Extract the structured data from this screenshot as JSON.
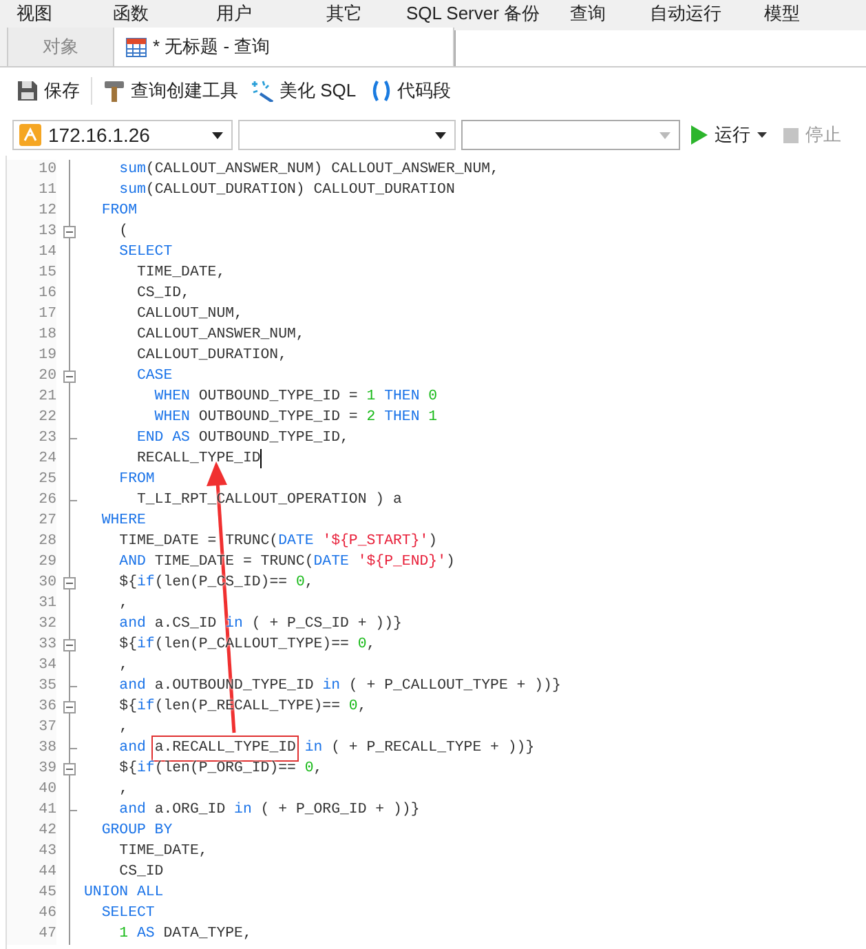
{
  "menu": [
    "视图",
    "函数",
    "用户",
    "其它",
    "SQL Server 备份",
    "查询",
    "自动运行",
    "模型"
  ],
  "tabs": [
    {
      "label": "对象",
      "selected": false,
      "icon": false
    },
    {
      "label": "* 无标题 - 查询",
      "selected": true,
      "icon": true
    }
  ],
  "toolbar": [
    {
      "kind": "save",
      "label": "保存"
    },
    {
      "kind": "builder",
      "label": "查询创建工具"
    },
    {
      "kind": "beautify",
      "label": "美化 SQL"
    },
    {
      "kind": "snippet",
      "label": "代码段"
    }
  ],
  "selectors": [
    {
      "value": "172.16.1.26",
      "disabled": false,
      "icon": true
    },
    {
      "disabled": false,
      "icon": false
    },
    {
      "disabled": true,
      "icon": false
    }
  ],
  "run": {
    "label": "运行",
    "disabled": false
  },
  "stop": {
    "label": "停止",
    "disabled": true
  },
  "editor": {
    "lines": [
      {
        "number": "10",
        "fold": false,
        "fold_end": false,
        "cursor": false,
        "tokens": [
          {
            "kind": "fn",
            "text": "    sum"
          },
          {
            "kind": "plain",
            "text": "(CALLOUT_ANSWER_NUM) CALLOUT_ANSWER_NUM,"
          }
        ]
      },
      {
        "number": "11",
        "fold": false,
        "fold_end": false,
        "cursor": false,
        "tokens": [
          {
            "kind": "fn",
            "text": "    sum"
          },
          {
            "kind": "plain",
            "text": "(CALLOUT_DURATION) CALLOUT_DURATION"
          }
        ]
      },
      {
        "number": "12",
        "fold": false,
        "fold_end": false,
        "cursor": false,
        "tokens": [
          {
            "kind": "kw",
            "text": "  FROM"
          }
        ]
      },
      {
        "number": "13",
        "fold": true,
        "fold_end": false,
        "cursor": false,
        "tokens": [
          {
            "kind": "plain",
            "text": "    ("
          }
        ]
      },
      {
        "number": "14",
        "fold": false,
        "fold_end": false,
        "cursor": false,
        "tokens": [
          {
            "kind": "kw",
            "text": "    SELECT"
          }
        ]
      },
      {
        "number": "15",
        "fold": false,
        "fold_end": false,
        "cursor": false,
        "tokens": [
          {
            "kind": "plain",
            "text": "      TIME_DATE,"
          }
        ]
      },
      {
        "number": "16",
        "fold": false,
        "fold_end": false,
        "cursor": false,
        "tokens": [
          {
            "kind": "plain",
            "text": "      CS_ID,"
          }
        ]
      },
      {
        "number": "17",
        "fold": false,
        "fold_end": false,
        "cursor": false,
        "tokens": [
          {
            "kind": "plain",
            "text": "      CALLOUT_NUM,"
          }
        ]
      },
      {
        "number": "18",
        "fold": false,
        "fold_end": false,
        "cursor": false,
        "tokens": [
          {
            "kind": "plain",
            "text": "      CALLOUT_ANSWER_NUM,"
          }
        ]
      },
      {
        "number": "19",
        "fold": false,
        "fold_end": false,
        "cursor": false,
        "tokens": [
          {
            "kind": "plain",
            "text": "      CALLOUT_DURATION,"
          }
        ]
      },
      {
        "number": "20",
        "fold": true,
        "fold_end": false,
        "cursor": false,
        "tokens": [
          {
            "kind": "kw",
            "text": "      CASE"
          }
        ]
      },
      {
        "number": "21",
        "fold": false,
        "fold_end": false,
        "cursor": false,
        "tokens": [
          {
            "kind": "kw",
            "text": "        WHEN"
          },
          {
            "kind": "plain",
            "text": " OUTBOUND_TYPE_ID = "
          },
          {
            "kind": "num",
            "text": "1"
          },
          {
            "kind": "kw",
            "text": " THEN "
          },
          {
            "kind": "num",
            "text": "0"
          }
        ]
      },
      {
        "number": "22",
        "fold": false,
        "fold_end": false,
        "cursor": false,
        "tokens": [
          {
            "kind": "kw",
            "text": "        WHEN"
          },
          {
            "kind": "plain",
            "text": " OUTBOUND_TYPE_ID = "
          },
          {
            "kind": "num",
            "text": "2"
          },
          {
            "kind": "kw",
            "text": " THEN "
          },
          {
            "kind": "num",
            "text": "1"
          }
        ]
      },
      {
        "number": "23",
        "fold": false,
        "fold_end": true,
        "cursor": false,
        "tokens": [
          {
            "kind": "kw",
            "text": "      END AS"
          },
          {
            "kind": "plain",
            "text": " OUTBOUND_TYPE_ID,"
          }
        ]
      },
      {
        "number": "24",
        "fold": false,
        "fold_end": false,
        "cursor": true,
        "tokens": [
          {
            "kind": "plain",
            "text": "      RECALL_TYPE_ID"
          }
        ]
      },
      {
        "number": "25",
        "fold": false,
        "fold_end": false,
        "cursor": false,
        "tokens": [
          {
            "kind": "kw",
            "text": "    FROM"
          }
        ]
      },
      {
        "number": "26",
        "fold": false,
        "fold_end": true,
        "cursor": false,
        "tokens": [
          {
            "kind": "plain",
            "text": "      T_LI_RPT_CALLOUT_OPERATION ) a"
          }
        ]
      },
      {
        "number": "27",
        "fold": false,
        "fold_end": false,
        "cursor": false,
        "tokens": [
          {
            "kind": "kw",
            "text": "  WHERE"
          }
        ]
      },
      {
        "number": "28",
        "fold": false,
        "fold_end": false,
        "cursor": false,
        "tokens": [
          {
            "kind": "plain",
            "text": "    TIME_DATE = TRUNC("
          },
          {
            "kind": "kw",
            "text": "DATE "
          },
          {
            "kind": "str",
            "text": "'${P_START}'"
          },
          {
            "kind": "plain",
            "text": ")"
          }
        ]
      },
      {
        "number": "29",
        "fold": false,
        "fold_end": false,
        "cursor": false,
        "tokens": [
          {
            "kind": "kw",
            "text": "    AND"
          },
          {
            "kind": "plain",
            "text": " TIME_DATE = TRUNC("
          },
          {
            "kind": "kw",
            "text": "DATE "
          },
          {
            "kind": "str",
            "text": "'${P_END}'"
          },
          {
            "kind": "plain",
            "text": ")"
          }
        ]
      },
      {
        "number": "30",
        "fold": true,
        "fold_end": false,
        "cursor": false,
        "tokens": [
          {
            "kind": "plain",
            "text": "    ${"
          },
          {
            "kind": "kw",
            "text": "if"
          },
          {
            "kind": "plain",
            "text": "(len(P_CS_ID)== "
          },
          {
            "kind": "num",
            "text": "0"
          },
          {
            "kind": "plain",
            "text": ","
          }
        ]
      },
      {
        "number": "31",
        "fold": false,
        "fold_end": false,
        "cursor": false,
        "tokens": [
          {
            "kind": "plain",
            "text": "    ,"
          }
        ]
      },
      {
        "number": "32",
        "fold": false,
        "fold_end": false,
        "cursor": false,
        "tokens": [
          {
            "kind": "kw",
            "text": "    and"
          },
          {
            "kind": "plain",
            "text": " a.CS_ID "
          },
          {
            "kind": "kw",
            "text": "in"
          },
          {
            "kind": "plain",
            "text": " ( + P_CS_ID + ))}"
          }
        ]
      },
      {
        "number": "33",
        "fold": true,
        "fold_end": false,
        "cursor": false,
        "tokens": [
          {
            "kind": "plain",
            "text": "    ${"
          },
          {
            "kind": "kw",
            "text": "if"
          },
          {
            "kind": "plain",
            "text": "(len(P_CALLOUT_TYPE)== "
          },
          {
            "kind": "num",
            "text": "0"
          },
          {
            "kind": "plain",
            "text": ","
          }
        ]
      },
      {
        "number": "34",
        "fold": false,
        "fold_end": false,
        "cursor": false,
        "tokens": [
          {
            "kind": "plain",
            "text": "    ,"
          }
        ]
      },
      {
        "number": "35",
        "fold": false,
        "fold_end": true,
        "cursor": false,
        "tokens": [
          {
            "kind": "kw",
            "text": "    and"
          },
          {
            "kind": "plain",
            "text": " a.OUTBOUND_TYPE_ID "
          },
          {
            "kind": "kw",
            "text": "in"
          },
          {
            "kind": "plain",
            "text": " ( + P_CALLOUT_TYPE + ))}"
          }
        ]
      },
      {
        "number": "36",
        "fold": true,
        "fold_end": false,
        "cursor": false,
        "tokens": [
          {
            "kind": "plain",
            "text": "    ${"
          },
          {
            "kind": "kw",
            "text": "if"
          },
          {
            "kind": "plain",
            "text": "(len(P_RECALL_TYPE)== "
          },
          {
            "kind": "num",
            "text": "0"
          },
          {
            "kind": "plain",
            "text": ","
          }
        ]
      },
      {
        "number": "37",
        "fold": false,
        "fold_end": false,
        "cursor": false,
        "tokens": [
          {
            "kind": "plain",
            "text": "    ,"
          }
        ]
      },
      {
        "number": "38",
        "fold": false,
        "fold_end": true,
        "cursor": false,
        "tokens": [
          {
            "kind": "kw",
            "text": "    and "
          },
          {
            "kind": "plain",
            "text": "a.RECALL_TYPE_ID",
            "boxed": true
          },
          {
            "kind": "kw",
            "text": " in"
          },
          {
            "kind": "plain",
            "text": " ( + P_RECALL_TYPE + ))}"
          }
        ]
      },
      {
        "number": "39",
        "fold": true,
        "fold_end": false,
        "cursor": false,
        "tokens": [
          {
            "kind": "plain",
            "text": "    ${"
          },
          {
            "kind": "kw",
            "text": "if"
          },
          {
            "kind": "plain",
            "text": "(len(P_ORG_ID)== "
          },
          {
            "kind": "num",
            "text": "0"
          },
          {
            "kind": "plain",
            "text": ","
          }
        ]
      },
      {
        "number": "40",
        "fold": false,
        "fold_end": false,
        "cursor": false,
        "tokens": [
          {
            "kind": "plain",
            "text": "    ,"
          }
        ]
      },
      {
        "number": "41",
        "fold": false,
        "fold_end": true,
        "cursor": false,
        "tokens": [
          {
            "kind": "kw",
            "text": "    and"
          },
          {
            "kind": "plain",
            "text": " a.ORG_ID "
          },
          {
            "kind": "kw",
            "text": "in"
          },
          {
            "kind": "plain",
            "text": " ( + P_ORG_ID + ))}"
          }
        ]
      },
      {
        "number": "42",
        "fold": false,
        "fold_end": false,
        "cursor": false,
        "tokens": [
          {
            "kind": "kw",
            "text": "  GROUP BY"
          }
        ]
      },
      {
        "number": "43",
        "fold": false,
        "fold_end": false,
        "cursor": false,
        "tokens": [
          {
            "kind": "plain",
            "text": "    TIME_DATE,"
          }
        ]
      },
      {
        "number": "44",
        "fold": false,
        "fold_end": false,
        "cursor": false,
        "tokens": [
          {
            "kind": "plain",
            "text": "    CS_ID"
          }
        ]
      },
      {
        "number": "45",
        "fold": false,
        "fold_end": false,
        "cursor": false,
        "tokens": [
          {
            "kind": "kw",
            "text": "UNION ALL"
          }
        ]
      },
      {
        "number": "46",
        "fold": false,
        "fold_end": false,
        "cursor": false,
        "tokens": [
          {
            "kind": "kw",
            "text": "  SELECT"
          }
        ]
      },
      {
        "number": "47",
        "fold": false,
        "fold_end": false,
        "cursor": false,
        "tokens": [
          {
            "kind": "num",
            "text": "    1"
          },
          {
            "kind": "kw",
            "text": " AS"
          },
          {
            "kind": "plain",
            "text": " DATA_TYPE,"
          }
        ]
      }
    ]
  }
}
